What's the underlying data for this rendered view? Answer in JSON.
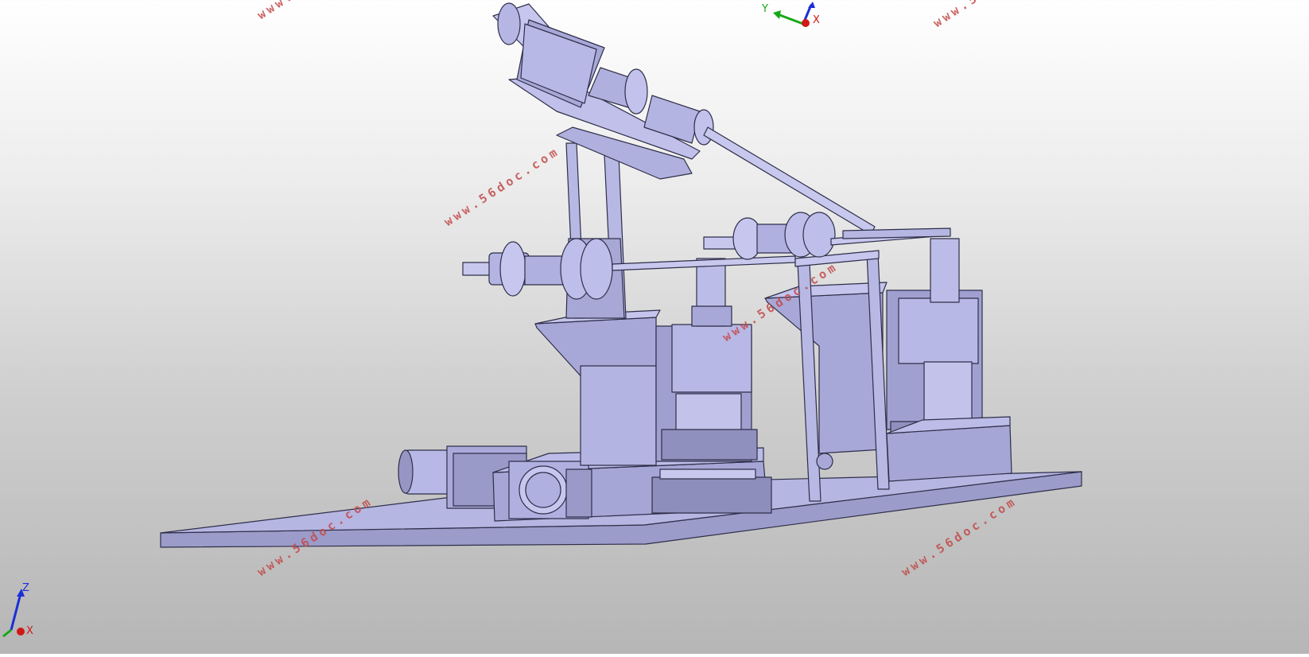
{
  "watermark_text": "www.56doc.com",
  "triad_top": {
    "x": "X",
    "y": "Y",
    "z": ""
  },
  "triad_bottom": {
    "x": "X",
    "z": "Z"
  },
  "colors": {
    "body": "#aeaedc",
    "body_dark": "#8a8ab8",
    "body_light": "#c8c8ee",
    "edge": "#2e2e4a",
    "axis_x": "#d01818",
    "axis_y": "#17a81a",
    "axis_z": "#1a2fd6",
    "watermark": "#c24a4a"
  }
}
